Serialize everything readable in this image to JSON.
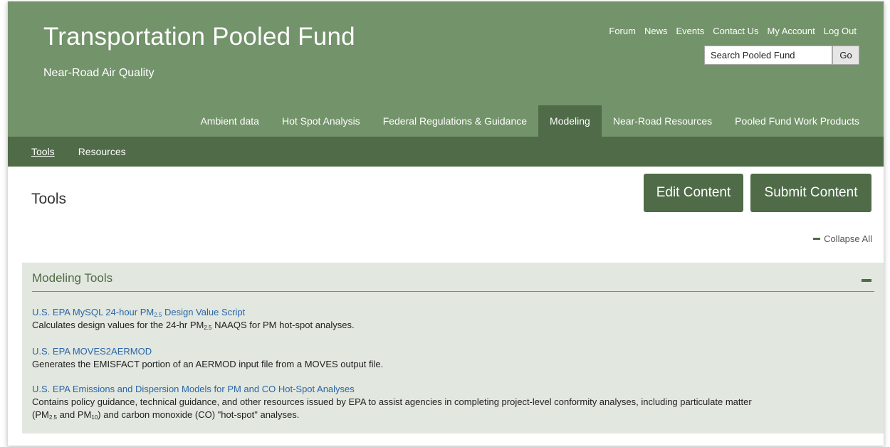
{
  "header": {
    "title": "Transportation Pooled Fund",
    "subtitle": "Near-Road Air Quality",
    "util_links": [
      "Forum",
      "News",
      "Events",
      "Contact Us",
      "My Account",
      "Log Out"
    ],
    "search_value": "Search Pooled Fund",
    "search_button": "Go"
  },
  "main_nav": {
    "tabs": [
      "Ambient data",
      "Hot Spot Analysis",
      "Federal Regulations & Guidance",
      "Modeling",
      "Near-Road Resources",
      "Pooled Fund Work Products"
    ],
    "active": "Modeling"
  },
  "sub_nav": {
    "items": [
      "Tools",
      "Resources"
    ],
    "active": "Tools"
  },
  "page": {
    "title": "Tools",
    "edit_button": "Edit Content",
    "submit_button": "Submit Content",
    "collapse_all": "Collapse All"
  },
  "panel": {
    "title": "Modeling Tools",
    "tools": [
      {
        "link_pre": "U.S. EPA MySQL 24-hour PM",
        "link_sub": "2.5",
        "link_post": " Design Value Script",
        "desc_pre": "Calculates design values for the 24-hr PM",
        "desc_sub": "2.5",
        "desc_post": " NAAQS for PM hot-spot analyses."
      },
      {
        "link": "U.S. EPA MOVES2AERMOD",
        "desc": "Generates the EMISFACT portion of an AERMOD input file from a MOVES output file."
      },
      {
        "link": "U.S. EPA Emissions and Dispersion Models for PM and CO Hot-Spot Analyses",
        "desc_line1": "Contains policy guidance, technical guidance, and other resources issued by EPA to assist agencies in completing project-level conformity analyses, including particulate matter",
        "desc_line2_a": "(PM",
        "desc_line2_sub1": "2.5",
        "desc_line2_b": " and PM",
        "desc_line2_sub2": "10",
        "desc_line2_c": ") and carbon monoxide (CO) \"hot-spot\" analyses."
      }
    ]
  },
  "colors": {
    "header_green": "#73936a",
    "dark_green": "#4f6b47",
    "panel_bg": "#e2e7df",
    "link_blue": "#2a66a8"
  }
}
